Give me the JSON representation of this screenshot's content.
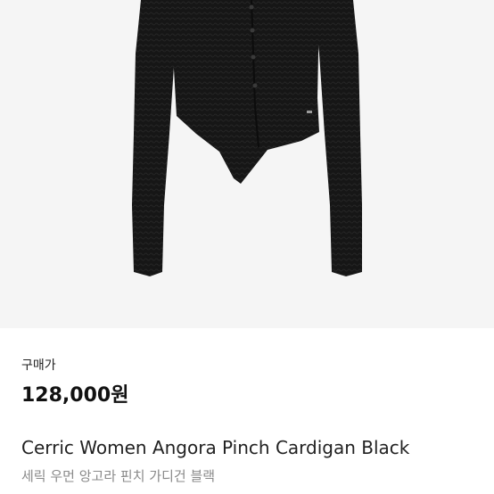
{
  "product": {
    "price_label": "구매가",
    "price": "128,000원",
    "name_en": "Cerric Women Angora Pinch Cardigan Black",
    "name_ko": "세릭 우먼 앙고라 핀치 가디건 블랙",
    "image_icon": "cardigan-photo"
  },
  "colors": {
    "image_bg": "#f5f5f5",
    "garment": "#161616",
    "muted_text": "#8a8a8a"
  }
}
